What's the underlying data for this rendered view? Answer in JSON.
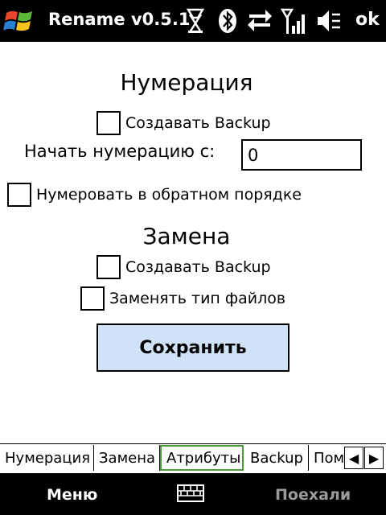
{
  "status_bar": {
    "app_title": "Rename v0.5.1",
    "ok_label": "ok",
    "icons": [
      "windows-start-icon",
      "tools-icon",
      "bluetooth-icon",
      "data-transfer-icon",
      "signal-strength-icon",
      "speaker-muted-icon"
    ]
  },
  "numbering": {
    "heading": "Нумерация",
    "backup_label": "Создавать Backup",
    "backup_checked": false,
    "start_label": "Начать нумерацию с:",
    "start_value": "0",
    "reverse_label": "Нумеровать в обратном порядке",
    "reverse_checked": false
  },
  "replace": {
    "heading": "Замена",
    "backup_label": "Создавать Backup",
    "backup_checked": false,
    "change_type_label": "Заменять тип файлов",
    "change_type_checked": false
  },
  "save_button": {
    "label": "Сохранить"
  },
  "tabs": [
    {
      "label": "Нумерация",
      "active": false
    },
    {
      "label": "Замена",
      "active": false
    },
    {
      "label": "Атрибуты",
      "active": true
    },
    {
      "label": "Backup",
      "active": false
    },
    {
      "label": "Пом",
      "active": false
    }
  ],
  "softkeys": {
    "left": "Меню",
    "right": "Поехали"
  },
  "colors": {
    "bar_background": "#000000",
    "save_button_bg": "#cfe2f8",
    "active_tab_border": "#4a9c3a",
    "disabled_softkey": "#9a9a9a"
  }
}
